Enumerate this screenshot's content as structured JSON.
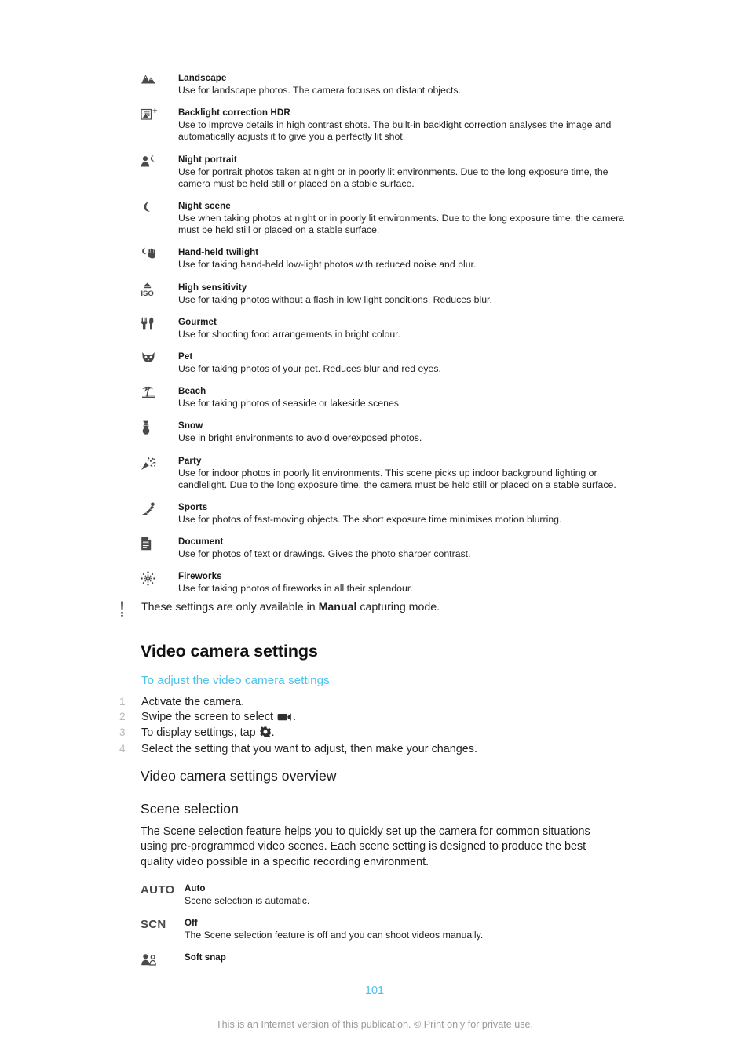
{
  "page": {
    "number": "101",
    "footer_note": "This is an Internet version of this publication. © Print only for private use."
  },
  "scene_modes": [
    {
      "icon": "landscape-mountain-icon",
      "title": "Landscape",
      "desc": "Use for landscape photos. The camera focuses on distant objects."
    },
    {
      "icon": "backlight-hdr-icon",
      "title": "Backlight correction HDR",
      "desc": "Use to improve details in high contrast shots. The built-in backlight correction analyses the image and automatically adjusts it to give you a perfectly lit shot."
    },
    {
      "icon": "night-portrait-icon",
      "title": "Night portrait",
      "desc": "Use for portrait photos taken at night or in poorly lit environments. Due to the long exposure time, the camera must be held still or placed on a stable surface."
    },
    {
      "icon": "night-scene-moon-icon",
      "title": "Night scene",
      "desc": "Use when taking photos at night or in poorly lit environments. Due to the long exposure time, the camera must be held still or placed on a stable surface."
    },
    {
      "icon": "hand-held-twilight-icon",
      "title": "Hand-held twilight",
      "desc": "Use for taking hand-held low-light photos with reduced noise and blur."
    },
    {
      "icon": "high-sensitivity-iso-icon",
      "title": "High sensitivity",
      "desc": "Use for taking photos without a flash in low light conditions. Reduces blur."
    },
    {
      "icon": "gourmet-cutlery-icon",
      "title": "Gourmet",
      "desc": "Use for shooting food arrangements in bright colour."
    },
    {
      "icon": "pet-cat-icon",
      "title": "Pet",
      "desc": "Use for taking photos of your pet. Reduces blur and red eyes."
    },
    {
      "icon": "beach-palm-icon",
      "title": "Beach",
      "desc": "Use for taking photos of seaside or lakeside scenes."
    },
    {
      "icon": "snow-snowman-icon",
      "title": "Snow",
      "desc": "Use in bright environments to avoid overexposed photos."
    },
    {
      "icon": "party-popper-icon",
      "title": "Party",
      "desc": "Use for indoor photos in poorly lit environments. This scene picks up indoor background lighting or candlelight. Due to the long exposure time, the camera must be held still or placed on a stable surface."
    },
    {
      "icon": "sports-runner-icon",
      "title": "Sports",
      "desc": "Use for photos of fast-moving objects. The short exposure time minimises motion blurring."
    },
    {
      "icon": "document-page-icon",
      "title": "Document",
      "desc": "Use for photos of text or drawings. Gives the photo sharper contrast."
    },
    {
      "icon": "fireworks-burst-icon",
      "title": "Fireworks",
      "desc": "Use for taking photos of fireworks in all their splendour."
    }
  ],
  "note": {
    "icon": "exclamation-warning-icon",
    "text_before": "These settings are only available in ",
    "bold": "Manual",
    "text_after": " capturing mode."
  },
  "video_camera_settings": {
    "heading": "Video camera settings",
    "procedure_link": "To adjust the video camera settings",
    "steps": [
      {
        "num": "1",
        "before": "Activate the camera.",
        "icon": "",
        "after": ""
      },
      {
        "num": "2",
        "before": "Swipe the screen to select ",
        "icon": "video-camera-icon",
        "after": "."
      },
      {
        "num": "3",
        "before": "To display settings, tap ",
        "icon": "gear-settings-icon",
        "after": "."
      },
      {
        "num": "4",
        "before": "Select the setting that you want to adjust, then make your changes.",
        "icon": "",
        "after": ""
      }
    ],
    "overview_heading": "Video camera settings overview",
    "scene_selection_heading": "Scene selection",
    "scene_selection_paragraph": "The Scene selection feature helps you to quickly set up the camera for common situations using pre-programmed video scenes. Each scene setting is designed to produce the best quality video possible in a specific recording environment.",
    "video_scenes": [
      {
        "icon": "auto-text-icon",
        "icon_text": "AUTO",
        "title": "Auto",
        "desc": "Scene selection is automatic."
      },
      {
        "icon": "scn-text-icon",
        "icon_text": "SCN",
        "title": "Off",
        "desc": "The Scene selection feature is off and you can shoot videos manually."
      },
      {
        "icon": "soft-snap-portrait-icon",
        "icon_text": "",
        "title": "Soft snap",
        "desc": ""
      }
    ]
  },
  "colors": {
    "link": "#4ec3e8",
    "body_text": "#231f20",
    "step_number": "#b9b9b9",
    "footer": "#9a9a9a"
  }
}
